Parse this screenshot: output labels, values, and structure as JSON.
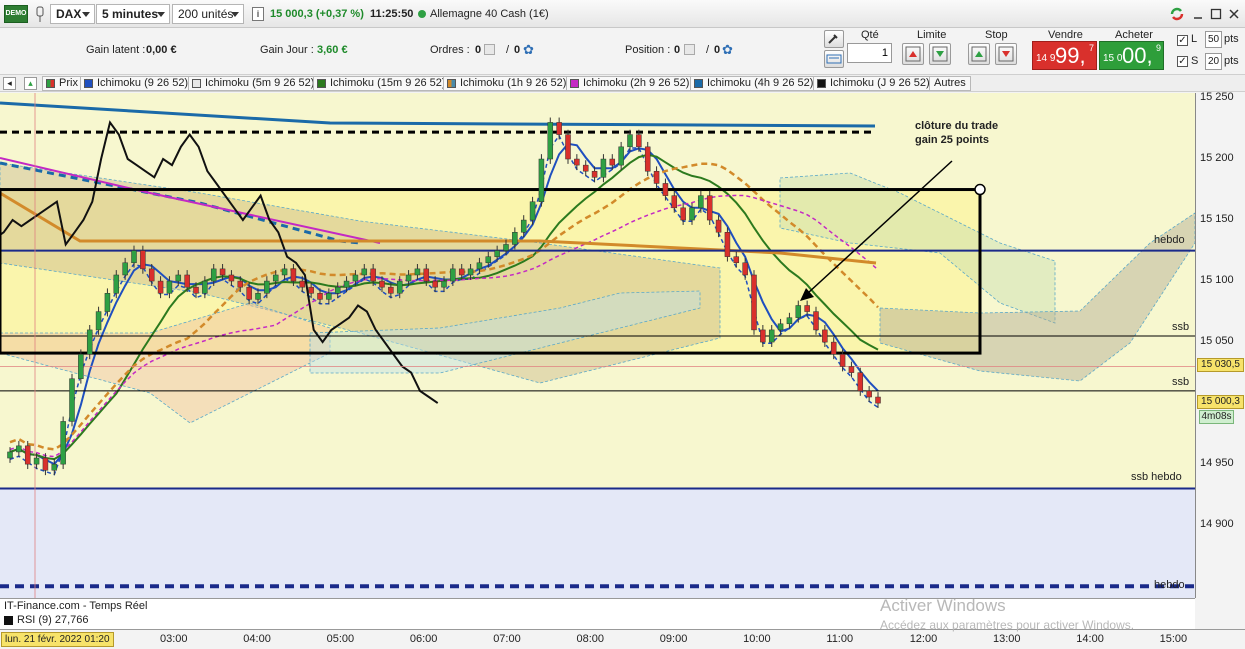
{
  "toolbar": {
    "demo_badge": "DEMO",
    "instrument": "DAX",
    "timeframe": "5 minutes",
    "units": "200 unités",
    "price_change": "15 000,3 (+0,37 %)",
    "time": "11:25:50",
    "market_name": "Allemagne 40 Cash (1€)"
  },
  "infobar": {
    "gain_latent_label": "Gain latent :",
    "gain_latent_value": "0,00 €",
    "gain_jour_label": "Gain Jour :",
    "gain_jour_value": "3,60 €",
    "ordres_label": "Ordres :",
    "ordres_count": "0",
    "ordres_other": "0",
    "position_label": "Position :",
    "position_count": "0",
    "position_other": "0"
  },
  "order_panel": {
    "qty_label": "Qté",
    "qty_value": "1",
    "limit_label": "Limite",
    "stop_label": "Stop",
    "sell_label": "Vendre",
    "sell_small": "14 9",
    "sell_big": "99,",
    "sell_sup": "7",
    "buy_label": "Acheter",
    "buy_small": "15 0",
    "buy_big": "00,",
    "buy_sup": "9",
    "l_label": "L",
    "l_value": "50",
    "s_label": "S",
    "s_value": "20",
    "pts": "pts",
    "colors": {
      "sell": "#d9302c",
      "buy": "#2e9e3a"
    }
  },
  "indicators": [
    {
      "label": "Prix",
      "color": "#2ea043"
    },
    {
      "label": "Ichimoku (9 26 52)",
      "color": "#1f4fbf"
    },
    {
      "label": "Ichimoku (5m 9 26 52)",
      "color": "#d6d6d6"
    },
    {
      "label": "Ichimoku (15m 9 26 52)",
      "color": "#2c7a1e"
    },
    {
      "label": "Ichimoku (1h 9 26 52)",
      "color": "#d28a2a"
    },
    {
      "label": "Ichimoku (2h 9 26 52)",
      "color": "#c428c4"
    },
    {
      "label": "Ichimoku (4h 9 26 52)",
      "color": "#1a6aa8"
    },
    {
      "label": "Ichimoku (J 9 26 52)",
      "color": "#111111"
    }
  ],
  "indicators_more": "Autres",
  "chart_data": {
    "type": "line",
    "title": "DAX 5 minutes",
    "yticks": [
      15250,
      15200,
      15150,
      15100,
      15050,
      14950,
      14900
    ],
    "ytick_labels": [
      "15 250",
      "15 200",
      "15 150",
      "15 100",
      "15 050",
      "14 950",
      "14 900"
    ],
    "xticks": [
      "03:00",
      "04:00",
      "05:00",
      "06:00",
      "07:00",
      "08:00",
      "09:00",
      "10:00",
      "11:00",
      "12:00",
      "13:00",
      "14:00",
      "15:00"
    ],
    "price_tag_1": "15 030,5",
    "price_tag_2": "15 000,3",
    "countdown": "4m08s",
    "levels": [
      {
        "label": "hebdo",
        "value": 15125
      },
      {
        "label": "ssb",
        "value": 15055
      },
      {
        "label": "ssb",
        "value": 15010
      },
      {
        "label": "ssb hebdo",
        "value": 14930
      },
      {
        "label": "hebdo",
        "value": 14850
      }
    ],
    "trade_box": {
      "high": 15175,
      "low": 15041
    },
    "annotation_line1": "clôture du trade",
    "annotation_line2": "gain 25 points",
    "close_values": [
      14960,
      14965,
      14950,
      14955,
      14945,
      14950,
      14985,
      15020,
      15040,
      15060,
      15075,
      15090,
      15105,
      15115,
      15125,
      15110,
      15100,
      15090,
      15100,
      15105,
      15095,
      15090,
      15100,
      15110,
      15105,
      15100,
      15095,
      15085,
      15090,
      15100,
      15105,
      15110,
      15100,
      15095,
      15090,
      15085,
      15090,
      15095,
      15100,
      15105,
      15110,
      15100,
      15095,
      15090,
      15100,
      15105,
      15110,
      15100,
      15095,
      15100,
      15110,
      15105,
      15110,
      15115,
      15120,
      15125,
      15130,
      15140,
      15150,
      15165,
      15200,
      15230,
      15220,
      15200,
      15195,
      15190,
      15185,
      15200,
      15195,
      15210,
      15220,
      15210,
      15190,
      15180,
      15170,
      15160,
      15150,
      15160,
      15170,
      15150,
      15140,
      15120,
      15115,
      15105,
      15060,
      15050,
      15060,
      15065,
      15070,
      15080,
      15075,
      15060,
      15050,
      15040,
      15030,
      15025,
      15010,
      15005,
      15000
    ],
    "series": [
      {
        "name": "Prix",
        "color": "#2ea043"
      },
      {
        "name": "Ichimoku (9 26 52)",
        "color": "#1f4fbf"
      },
      {
        "name": "Ichimoku (15m 9 26 52)",
        "color": "#2c7a1e"
      },
      {
        "name": "Ichimoku (1h 9 26 52)",
        "color": "#d28a2a"
      },
      {
        "name": "Ichimoku (2h 9 26 52)",
        "color": "#c428c4"
      },
      {
        "name": "Ichimoku (4h 9 26 52)",
        "color": "#1a6aa8"
      },
      {
        "name": "Ichimoku (J 9 26 52)",
        "color": "#111111"
      }
    ]
  },
  "footer": {
    "source": "IT-Finance.com - Temps Réel",
    "rsi": "RSI (9) 27,766",
    "date_start": "lun. 21 févr. 2022 01:20"
  },
  "watermark": {
    "line1": "Activer Windows",
    "line2": "Accédez aux paramètres pour activer Windows."
  }
}
